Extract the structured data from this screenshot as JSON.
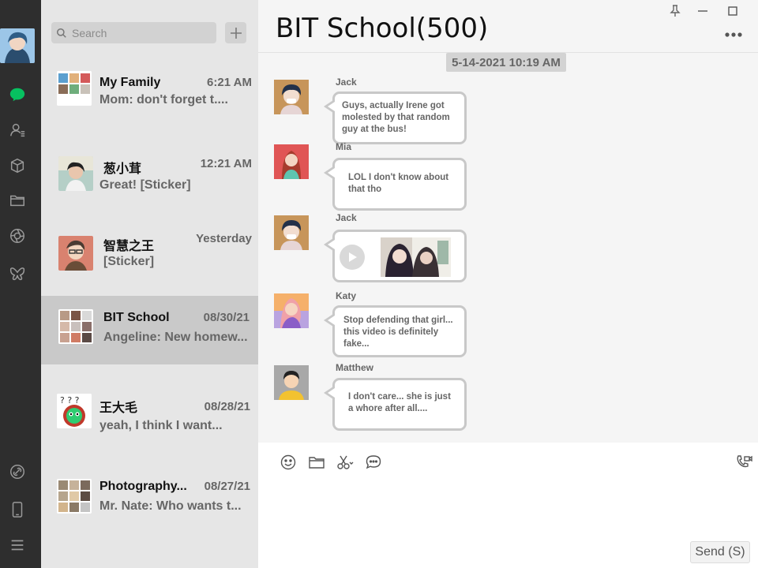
{
  "search": {
    "placeholder": "Search"
  },
  "conversations": [
    {
      "name": "My Family",
      "time": "6:21 AM",
      "preview": "Mom: don't forget t...."
    },
    {
      "name": "葱小茸",
      "time": "12:21 AM",
      "preview": "Great! [Sticker]"
    },
    {
      "name": "智慧之王",
      "time": "Yesterday",
      "preview": "[Sticker]"
    },
    {
      "name": "BIT School",
      "time": "08/30/21",
      "preview": "Angeline: New homew..."
    },
    {
      "name": "王大毛",
      "time": "08/28/21",
      "preview": "yeah, I think I want..."
    },
    {
      "name": "Photography...",
      "time": "08/27/21",
      "preview": "Mr. Nate: Who wants t..."
    }
  ],
  "chat": {
    "title": "BIT School(500)",
    "date_chip": "5-14-2021 10:19 AM",
    "messages": [
      {
        "sender": "Jack",
        "text": "Guys, actually Irene got molested by that random guy at the bus!"
      },
      {
        "sender": "Mia",
        "text": "LOL I don't know about that tho"
      },
      {
        "sender": "Jack",
        "text": ""
      },
      {
        "sender": "Katy",
        "text": "Stop defending that girl... this video is definitely fake..."
      },
      {
        "sender": "Matthew",
        "text": "I don't care... she is just a whore after all...."
      }
    ],
    "send_label": "Send (S)"
  },
  "icons": {
    "rail": [
      "chat-icon",
      "contacts-icon",
      "cube-icon",
      "folder-icon",
      "aperture-icon",
      "butterfly-icon",
      "link-icon",
      "phone-icon",
      "menu-icon"
    ],
    "toolbar": [
      "emoji-icon",
      "folder-icon",
      "scissors-icon",
      "comment-icon",
      "video-call-icon"
    ],
    "window": [
      "pin-icon",
      "minimize-icon",
      "maximize-icon"
    ]
  },
  "colors": {
    "accent": "#07c160",
    "rail_bg": "#2e2e2e",
    "list_bg": "#e6e6e6",
    "selected_bg": "#c9c9c9"
  }
}
